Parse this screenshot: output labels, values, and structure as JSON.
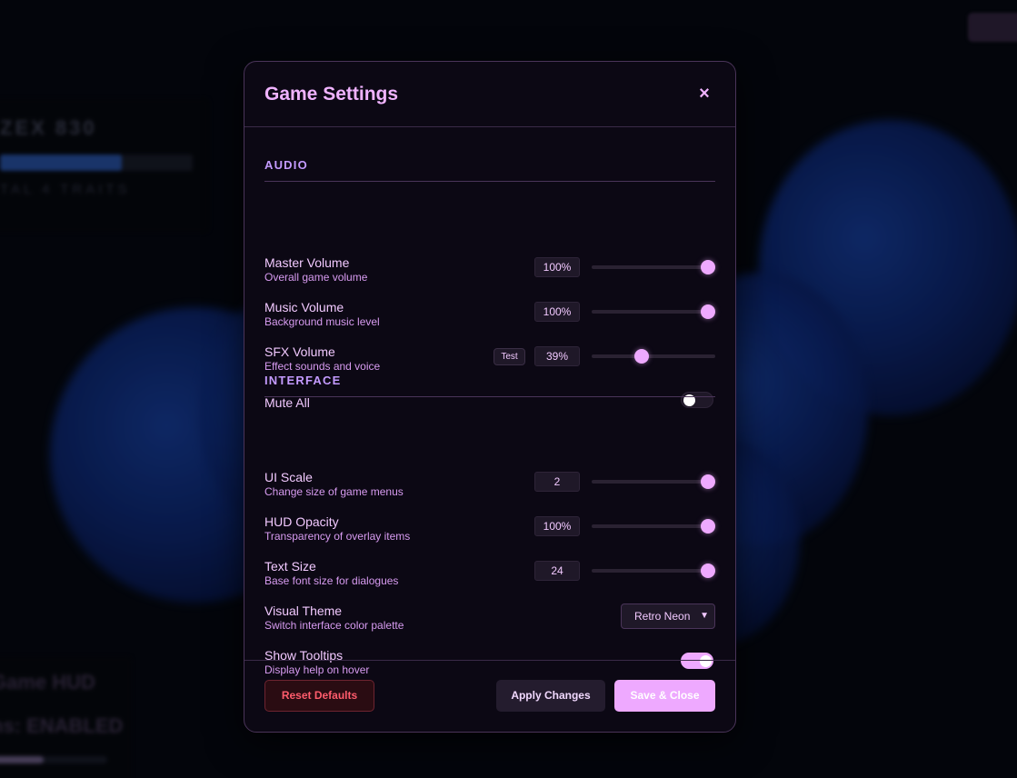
{
  "background": {
    "panel_top": {
      "title": "ZEX 830",
      "subtitle": "TAL 4 TRAITS",
      "progress": 0.63
    },
    "panel_bottom": {
      "line1": "Game HUD",
      "line2": "ns: ENABLED",
      "progress": 0.45
    }
  },
  "modal": {
    "title": "Game Settings",
    "close_icon": "×",
    "sections": {
      "audio": {
        "title": "AUDIO",
        "master_volume": {
          "label": "Master Volume",
          "desc": "Overall game volume",
          "value": "100%",
          "level": 1.0
        },
        "music_volume": {
          "label": "Music Volume",
          "desc": "Background music level",
          "value": "100%",
          "level": 1.0
        },
        "sfx_volume": {
          "label": "SFX Volume",
          "desc": "Effect sounds and voice",
          "value": "39%",
          "level": 0.39,
          "test_label": "Test"
        },
        "mute_all": {
          "label": "Mute All",
          "enabled": false
        }
      },
      "interface": {
        "title": "INTERFACE",
        "ui_scale": {
          "label": "UI Scale",
          "desc": "Change size of game menus",
          "value": "2",
          "level": 1.0
        },
        "hud_opacity": {
          "label": "HUD Opacity",
          "desc": "Transparency of overlay items",
          "value": "100%",
          "level": 1.0
        },
        "text_size": {
          "label": "Text Size",
          "desc": "Base font size for dialogues",
          "value": "24",
          "level": 1.0
        },
        "visual_theme": {
          "label": "Visual Theme",
          "desc": "Switch interface color palette",
          "selected": "Retro Neon"
        },
        "show_tooltips": {
          "label": "Show Tooltips",
          "desc": "Display help on hover",
          "enabled": true
        }
      }
    },
    "footer": {
      "reset_label": "Reset Defaults",
      "apply_label": "Apply Changes",
      "save_label": "Save & Close"
    }
  },
  "colors": {
    "accent": "#eea9ff",
    "panel_bg": "#0c0814",
    "danger": "#ff5c6c",
    "section_title": "#c49bff"
  }
}
